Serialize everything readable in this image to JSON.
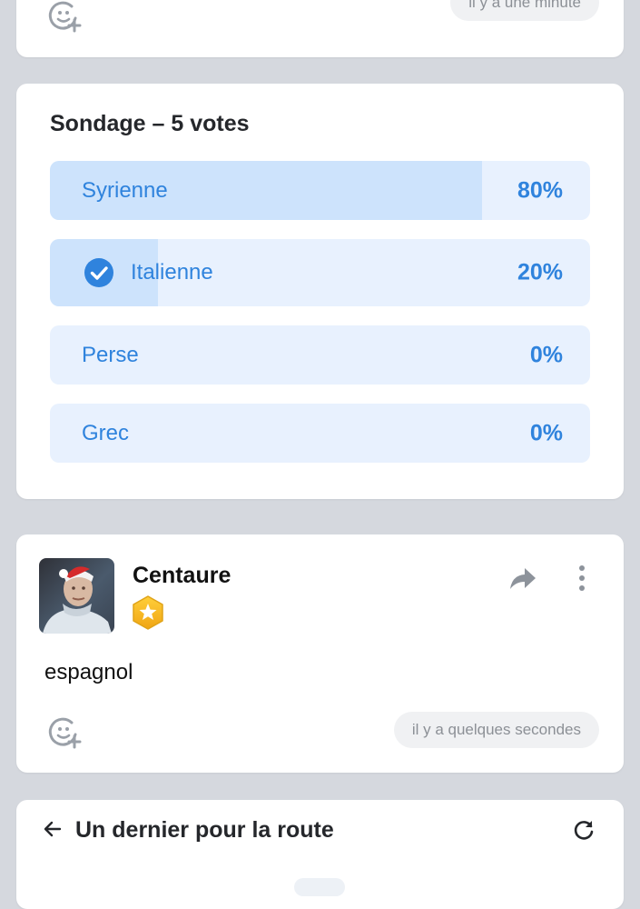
{
  "previous_post": {
    "time": "il y a une minute",
    "react_icon": "add-reaction-icon"
  },
  "poll": {
    "title": "Sondage – 5 votes",
    "accent_color": "#2f83dd",
    "fill_color": "#cde3fc",
    "track_color": "#e8f1fe",
    "options": [
      {
        "label": "Syrienne",
        "percent": "80%",
        "share": 0.8,
        "selected": false
      },
      {
        "label": "Italienne",
        "percent": "20%",
        "share": 0.2,
        "selected": true
      },
      {
        "label": "Perse",
        "percent": "0%",
        "share": 0,
        "selected": false
      },
      {
        "label": "Grec",
        "percent": "0%",
        "share": 0,
        "selected": false
      }
    ]
  },
  "post": {
    "author": "Centaure",
    "badge_icon": "star-badge-icon",
    "share_icon": "share-icon",
    "more_icon": "more-vertical-icon",
    "text": "espagnol",
    "time": "il y a quelques secondes",
    "react_icon": "add-reaction-icon"
  },
  "room": {
    "back_icon": "arrow-left-icon",
    "title": "Un dernier pour la route",
    "refresh_icon": "refresh-icon"
  }
}
